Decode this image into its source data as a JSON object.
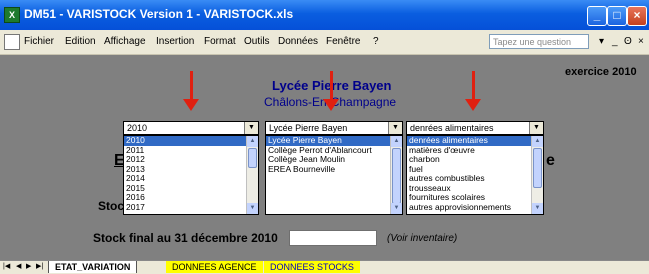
{
  "titlebar": {
    "app_title": "DM51 - VARISTOCK Version 1 - VARISTOCK.xls",
    "icon_letter": "X",
    "minimize": "_",
    "maximize": "□",
    "close": "×"
  },
  "menubar": {
    "items": [
      "Fichier",
      "Edition",
      "Affichage",
      "Insertion",
      "Format",
      "Outils",
      "Données",
      "Fenêtre",
      "?"
    ],
    "help_placeholder": "Tapez une question",
    "right_controls": [
      "▾",
      "_",
      "ʘ",
      "×"
    ]
  },
  "sheet": {
    "exercise_label": "exercice 2010",
    "school_name": "Lycée Pierre Bayen",
    "city": "Châlons-En-Champagne",
    "year_select": {
      "value": "2010",
      "options": [
        "2010",
        "2011",
        "2012",
        "2013",
        "2014",
        "2015",
        "2016",
        "2017"
      ]
    },
    "school_select": {
      "value": "Lycée Pierre Bayen",
      "options": [
        "Lycée Pierre Bayen",
        "Collège Perrot d'Ablancourt",
        "Collège Jean Moulin",
        "EREA Bourneville"
      ]
    },
    "category_select": {
      "value": "denrées alimentaires",
      "options": [
        "denrées alimentaires",
        "matières d'œuvre",
        "charbon",
        "fuel",
        "autres combustibles",
        "trousseaux",
        "fournitures scolaires",
        "autres approvisionnements"
      ]
    },
    "partial_label_left": "E",
    "partial_label_right": "e",
    "partial_stock_label": "Stoc",
    "final_stock_label": "Stock final au 31 décembre 2010",
    "final_stock_value": "",
    "inventory_note": "(Voir inventaire)"
  },
  "tabs": {
    "nav": [
      "|◀",
      "◀",
      "▶",
      "▶|"
    ],
    "sheets": [
      "ETAT_VARIATION",
      "DONNEES AGENCE",
      "DONNEES STOCKS"
    ]
  },
  "colors": {
    "arrow": "#e02010",
    "title_blue": "#00008b",
    "selection": "#316ac5",
    "tab_yellow": "#ffff00"
  }
}
